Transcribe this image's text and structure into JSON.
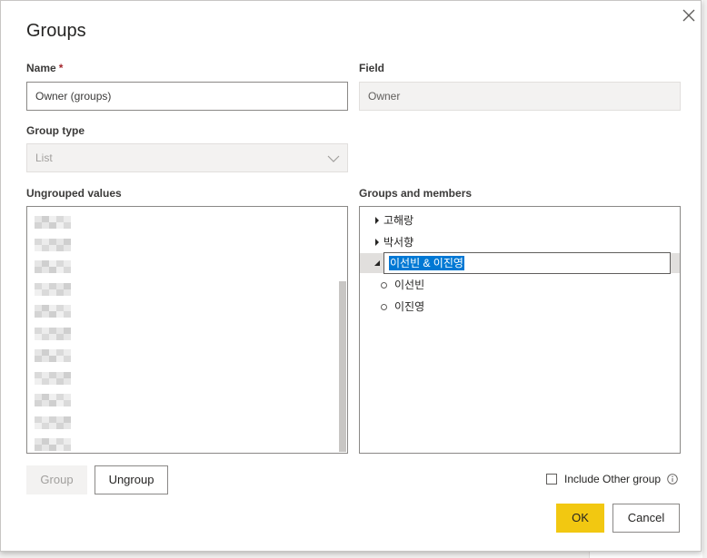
{
  "dialog": {
    "title": "Groups",
    "name_label": "Name",
    "required_mark": "*",
    "name_value": "Owner (groups)",
    "field_label": "Field",
    "field_value": "Owner",
    "group_type_label": "Group type",
    "group_type_value": "List",
    "ungrouped_label": "Ungrouped values",
    "groups_label": "Groups and members",
    "groups": [
      {
        "label": "고해랑",
        "expanded": false
      },
      {
        "label": "박서향",
        "expanded": false
      },
      {
        "label": "이선빈 & 이진영",
        "expanded": true,
        "editing": true
      }
    ],
    "members": [
      "이선빈",
      "이진영"
    ],
    "buttons": {
      "group": "Group",
      "ungroup": "Ungroup",
      "ok": "OK",
      "cancel": "Cancel"
    },
    "include_other_label": "Include Other group",
    "include_other_checked": false
  },
  "icons": {
    "close": "close-icon",
    "dropdown": "chevron-down-icon",
    "info": "info-icon"
  },
  "colors": {
    "primary_button": "#f2c811",
    "selection": "#0078d4"
  }
}
